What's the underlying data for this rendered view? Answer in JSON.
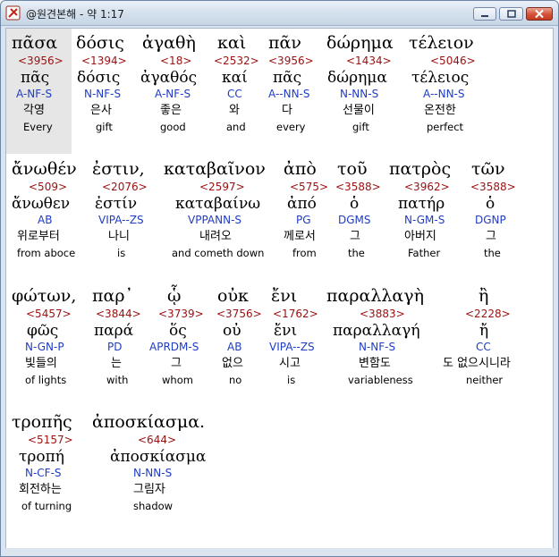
{
  "window": {
    "title": "@원견본해 - 약 1:17"
  },
  "rows": [
    {
      "words": [
        {
          "greek": "πᾶσα",
          "strong": "<3956>",
          "lemma": "πᾶς",
          "parse": "A-NF-S",
          "korean": "각영",
          "english": "Every"
        },
        {
          "greek": "δόσις",
          "strong": "<1394>",
          "lemma": "δόσις",
          "parse": "N-NF-S",
          "korean": "은사",
          "english": "gift"
        },
        {
          "greek": "ἀγαθὴ",
          "strong": "<18>",
          "lemma": "ἀγαθός",
          "parse": "A-NF-S",
          "korean": "좋은",
          "english": "good"
        },
        {
          "greek": "καὶ",
          "strong": "<2532>",
          "lemma": "καί",
          "parse": "CC",
          "korean": "와",
          "english": "and"
        },
        {
          "greek": "πᾶν",
          "strong": "<3956>",
          "lemma": "πᾶς",
          "parse": "A--NN-S",
          "korean": "다",
          "english": "every"
        },
        {
          "greek": "δώρημα",
          "strong": "<1434>",
          "lemma": "δώρημα",
          "parse": "N-NN-S",
          "korean": "선물이",
          "english": "gift"
        },
        {
          "greek": "τέλειον",
          "strong": "<5046>",
          "lemma": "τέλειος",
          "parse": "A--NN-S",
          "korean": "온전한",
          "english": "perfect"
        }
      ]
    },
    {
      "words": [
        {
          "greek": "ἄνωθέν",
          "strong": "<509>",
          "lemma": "ἄνωθεν",
          "parse": "AB",
          "korean": "위로부터",
          "english": "from aboce"
        },
        {
          "greek": "ἐστιν,",
          "strong": "<2076>",
          "lemma": "ἐστίν",
          "parse": "VIPA--ZS",
          "korean": "나니",
          "english": "is"
        },
        {
          "greek": "καταβαῖνον",
          "strong": "<2597>",
          "lemma": "καταβαίνω",
          "parse": "VPPANN-S",
          "korean": "내려오",
          "english": "and cometh down"
        },
        {
          "greek": "ἀπὸ",
          "strong": "<575>",
          "lemma": "ἀπό",
          "parse": "PG",
          "korean": "께로서",
          "english": "from"
        },
        {
          "greek": "τοῦ",
          "strong": "<3588>",
          "lemma": "ὁ",
          "parse": "DGMS",
          "korean": "그",
          "english": "the"
        },
        {
          "greek": "πατρὸς",
          "strong": "<3962>",
          "lemma": "πατήρ",
          "parse": "N-GM-S",
          "korean": "아버지",
          "english": "Father"
        },
        {
          "greek": "τῶν",
          "strong": "<3588>",
          "lemma": "ὁ",
          "parse": "DGNP",
          "korean": "그",
          "english": "the"
        }
      ]
    },
    {
      "words": [
        {
          "greek": "φώτων,",
          "strong": "<5457>",
          "lemma": "φῶς",
          "parse": "N-GN-P",
          "korean": "빛들의",
          "english": "of lights"
        },
        {
          "greek": "παρ᾽",
          "strong": "<3844>",
          "lemma": "παρά",
          "parse": "PD",
          "korean": "는",
          "english": "with"
        },
        {
          "greek": "ᾧ",
          "strong": "<3739>",
          "lemma": "ὅς",
          "parse": "APRDM-S",
          "korean": "그",
          "english": "whom"
        },
        {
          "greek": "οὐκ",
          "strong": "<3756>",
          "lemma": "οὐ",
          "parse": "AB",
          "korean": "없으",
          "english": "no"
        },
        {
          "greek": "ἔνι",
          "strong": "<1762>",
          "lemma": "ἔνι",
          "parse": "VIPA--ZS",
          "korean": "시고",
          "english": "is"
        },
        {
          "greek": "παραλλαγὴ",
          "strong": "<3883>",
          "lemma": "παραλλαγή",
          "parse": "N-NF-S",
          "korean": "변함도",
          "english": "variableness"
        },
        {
          "greek": "ἢ",
          "strong": "<2228>",
          "lemma": "ἤ",
          "parse": "CC",
          "korean": "도 없으시니라",
          "english": "neither"
        }
      ]
    },
    {
      "words": [
        {
          "greek": "τροπῆς",
          "strong": "<5157>",
          "lemma": "τροπή",
          "parse": "N-CF-S",
          "korean": "회전하는",
          "english": "of turning"
        },
        {
          "greek": "ἀποσκίασμα.",
          "strong": "<644>",
          "lemma": "ἀποσκίασμα",
          "parse": "N-NN-S",
          "korean": "그림자",
          "english": "shadow"
        }
      ]
    }
  ]
}
